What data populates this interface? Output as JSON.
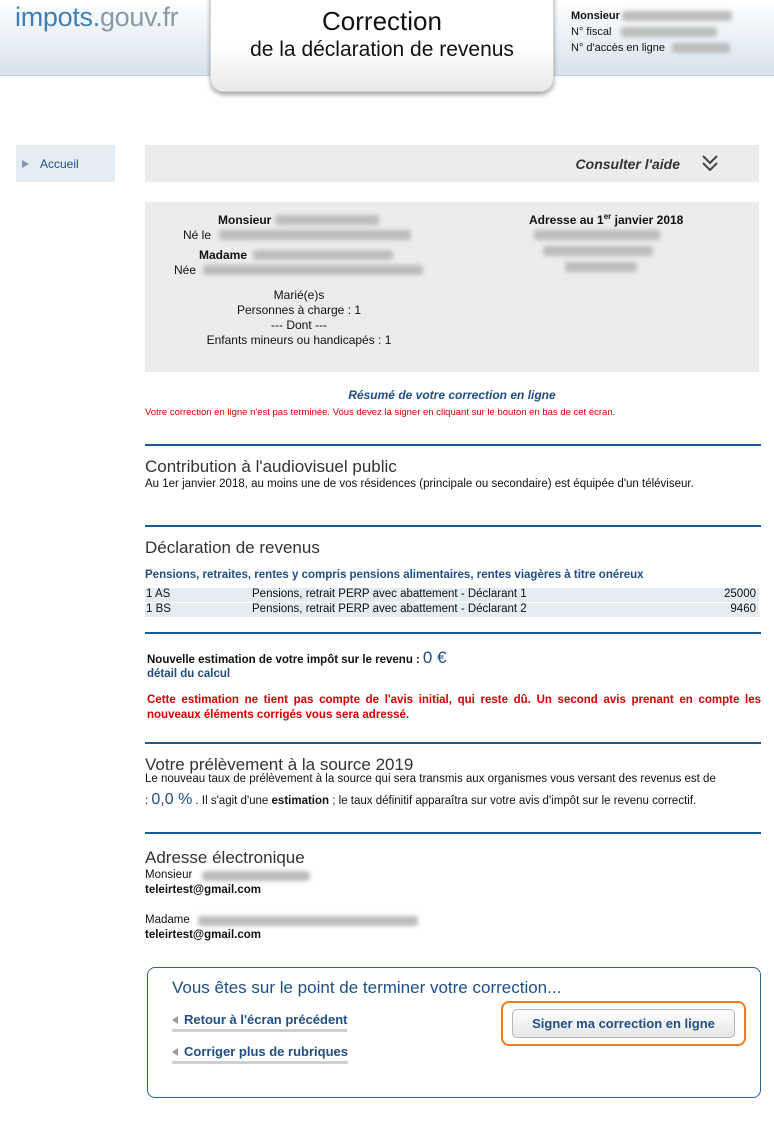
{
  "header": {
    "logo_part1": "impots.",
    "logo_part2": "gouv.fr",
    "title_line1": "Correction",
    "title_line2": "de la déclaration de revenus",
    "user_title": "Monsieur",
    "fiscal_label": "N° fiscal",
    "access_label": "N° d'accès en ligne"
  },
  "sidebar": {
    "home_label": "Accueil"
  },
  "help": {
    "label": "Consulter l'aide"
  },
  "identity": {
    "monsieur_label": "Monsieur",
    "ne_le_label": "Né le",
    "madame_label": "Madame",
    "nee_label": "Née",
    "address_label_pre": "Adresse au 1",
    "address_label_sup": "er",
    "address_label_post": " janvier 2018",
    "status": "Marié(e)s",
    "dependents": "Personnes à charge : 1",
    "dont": "--- Dont ---",
    "children": "Enfants mineurs ou handicapés : 1"
  },
  "summary": {
    "title": "Résumé de votre correction en ligne",
    "warning": "Votre correction en ligne n'est pas terminée. Vous devez la signer en cliquant sur le bouton en bas de cet écran."
  },
  "audiovisual": {
    "title": "Contribution à l'audiovisuel public",
    "text": "Au 1er janvier 2018, au moins une de vos résidences (principale ou secondaire) est équipée d'un téléviseur."
  },
  "income": {
    "title": "Déclaration de revenus",
    "category": "Pensions, retraites, rentes y compris pensions alimentaires, rentes viagères à titre onéreux",
    "rows": [
      {
        "code": "1 AS",
        "label": "Pensions, retrait PERP avec abattement - Déclarant 1",
        "amount": "25000"
      },
      {
        "code": "1 BS",
        "label": "Pensions, retrait PERP avec abattement - Déclarant 2",
        "amount": "9460"
      }
    ]
  },
  "estimate": {
    "label": "Nouvelle estimation de votre impôt sur le revenu :",
    "value": "0 €",
    "detail_link": "détail du calcul",
    "note": "Cette estimation ne tient pas compte de l'avis initial, qui reste dû. Un second avis prenant en compte les nouveaux éléments corrigés vous sera adressé."
  },
  "withholding": {
    "title": "Votre prélèvement à la source 2019",
    "text1": "Le nouveau taux de prélèvement à la source qui sera transmis aux organismes vous versant des revenus est de",
    "text2_prefix": ":",
    "rate": "0,0 %",
    "text2_mid": ". Il s'agit d'une",
    "text2_bold": "estimation",
    "text2_suffix": "; le taux définitif apparaîtra sur votre avis d'impôt sur le revenu correctif."
  },
  "email": {
    "title": "Adresse électronique",
    "monsieur_label": "Monsieur",
    "monsieur_email": "teleirtest@gmail.com",
    "madame_label": "Madame",
    "madame_email": "teleirtest@gmail.com"
  },
  "final": {
    "title": "Vous êtes sur le point de terminer votre correction...",
    "back_label": "Retour à l'écran précédent",
    "more_label": "Corriger plus de rubriques",
    "sign_label": "Signer ma correction en ligne"
  },
  "colors": {
    "brand_blue": "#214e82",
    "alert_red": "#d30000",
    "highlight_orange": "#ef7d1a"
  }
}
